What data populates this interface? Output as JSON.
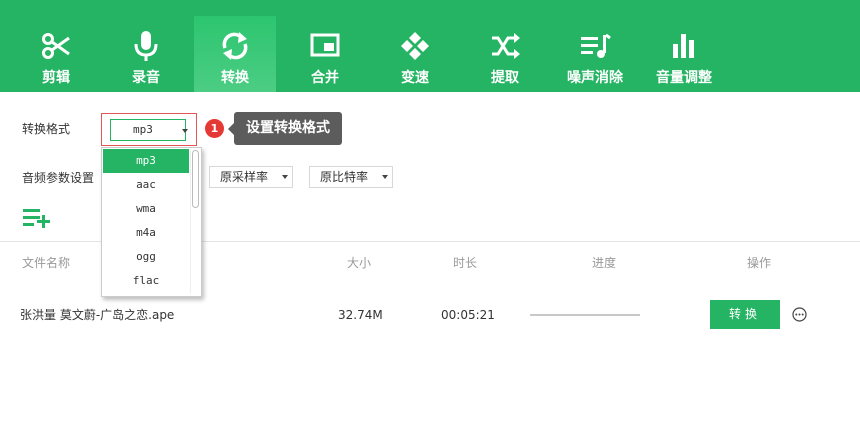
{
  "toolbar": {
    "items": [
      {
        "label": "剪辑",
        "icon": "scissors-icon"
      },
      {
        "label": "录音",
        "icon": "microphone-icon"
      },
      {
        "label": "转换",
        "icon": "convert-icon",
        "active": true
      },
      {
        "label": "合并",
        "icon": "merge-icon"
      },
      {
        "label": "变速",
        "icon": "speed-icon"
      },
      {
        "label": "提取",
        "icon": "extract-icon"
      },
      {
        "label": "噪声消除",
        "icon": "noise-removal-icon"
      },
      {
        "label": "音量调整",
        "icon": "volume-adjust-icon"
      }
    ],
    "background": "#25b463"
  },
  "settings": {
    "format_label": "转换格式",
    "format_value": "mp3",
    "audio_params_label": "音频参数设置",
    "sample_rate_value": "原采样率",
    "bitrate_value": "原比特率"
  },
  "tooltip": {
    "badge": "1",
    "text": "设置转换格式"
  },
  "dropdown": {
    "options": [
      "mp3",
      "aac",
      "wma",
      "m4a",
      "ogg",
      "flac"
    ],
    "selected": "mp3"
  },
  "table": {
    "headers": {
      "name": "文件名称",
      "size": "大小",
      "duration": "时长",
      "progress": "进度",
      "action": "操作"
    },
    "rows": [
      {
        "name": "张洪量 莫文蔚-广岛之恋.ape",
        "size": "32.74M",
        "duration": "00:05:21",
        "progress": 0,
        "action_label": "转换"
      }
    ]
  },
  "colors": {
    "accent": "#25b463",
    "badge": "#e53935",
    "tooltip": "#5c5c5c"
  }
}
